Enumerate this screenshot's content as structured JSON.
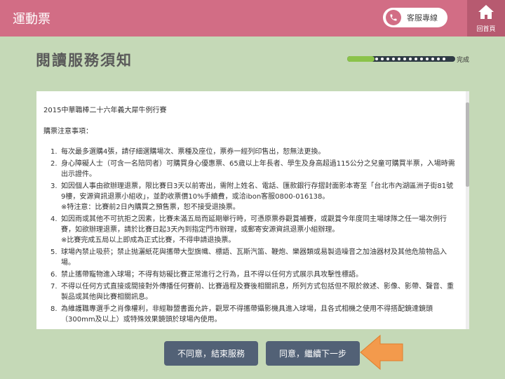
{
  "header": {
    "app_title": "運動票",
    "service_label": "客服專線",
    "home_label": "回首頁"
  },
  "page": {
    "title": "閱讀服務須知",
    "progress_label": "完成",
    "progress_fraction": 0.25
  },
  "notice": {
    "doc_title": "2015中華職棒二十六年義大犀牛例行賽",
    "header": "購票注意事項：",
    "rules": [
      {
        "num": "1.",
        "text": "每次最多選購4張，請仔細選購場次、票種及座位，票券一經列印售出，恕無法更換。"
      },
      {
        "num": "2.",
        "text": "身心障礙人士（可含一名陪同者）可購買身心優惠票、65歲以上年長者、學生及身高超過115公分之兒童可購買半票，入場時需出示證件。"
      },
      {
        "num": "3.",
        "text": "如因個人事由欲辦理退票，限比賽日3天以前寄出，需附上姓名、電話、匯款銀行存摺封面影本寄至「台北市內湖區洲子街81號9樓，安源資訊退票小組收」，並酌收票價10%手續費，或洽ibon客服0800-016138。",
        "extra": "※特注意：比賽前2日內購買之預售票，恕不接受退換票。"
      },
      {
        "num": "4.",
        "text": "如因雨或其他不可抗拒之因素，比賽未滿五局而延期舉行時，可憑原票券觀賞補賽，或觀賞今年度同主場球隊之任一場次例行賽，如欲辦理退票，請於比賽日起3天內到指定門市辦理，或郵寄安源資訊退票小組辦理。",
        "extra": "※比賽完成五局以上即成為正式比賽，不得申請退換票。"
      },
      {
        "num": "5.",
        "text": "球場內禁止吸菸；禁止抛灑紙花與攜帶大型旗幟、標語、瓦斯汽笛、鞭炮、樂器類或易製造噪音之加油器材及其他危險物品入場。"
      },
      {
        "num": "6.",
        "text": "禁止攜帶寵物進入球場；不得有妨礙比賽正常進行之行為，且不得以任何方式展示具攻擊性標語。"
      },
      {
        "num": "7.",
        "text": "不得以任何方式直接或間接對外傳播任何賽前、比賽過程及賽後相關訊息，所列方式包括但不限於敘述、影像、影帶、聲音、重製品或其他與比賽相關訊息。"
      },
      {
        "num": "8.",
        "text": "為維護職專選手之肖像權利，非經聯盟書面允許，觀眾不得攜帶攝影機具進入球場，且各式相機之使用不得搭配鏡達鏡頭（300mm及以上）或特殊效果鏡頭於球場內使用。"
      }
    ]
  },
  "actions": {
    "decline_label": "不同意，結束服務",
    "agree_label": "同意，繼續下一步"
  },
  "colors": {
    "header_bg": "#d26d85",
    "page_bg": "#c5d9b7",
    "button_bg": "#526176",
    "arrow": "#f39a4c",
    "progress_fill": "#8bc34a"
  }
}
